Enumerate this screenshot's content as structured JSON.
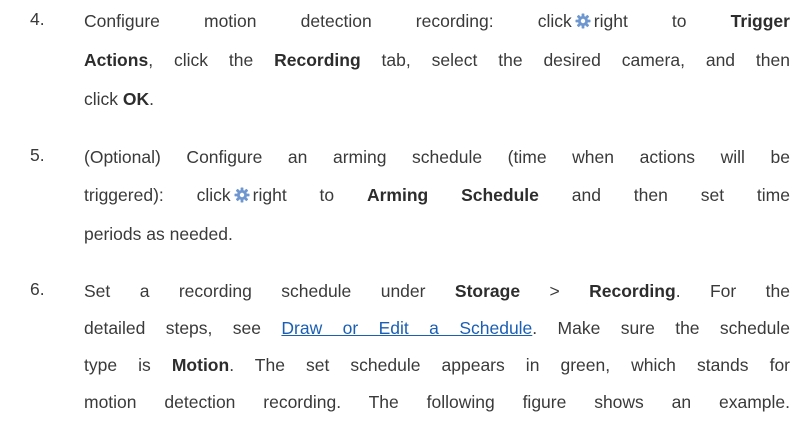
{
  "steps": [
    {
      "number": "4.",
      "lines": [
        {
          "justify": true,
          "parts": [
            {
              "t": "text",
              "v": "Configure motion detection recording: click"
            },
            {
              "t": "icon",
              "v": "gear-icon"
            },
            {
              "t": "text",
              "v": "right to "
            },
            {
              "t": "bold",
              "v": "Trigger"
            }
          ]
        },
        {
          "justify": true,
          "parts": [
            {
              "t": "bold",
              "v": "Actions"
            },
            {
              "t": "text",
              "v": ", click the "
            },
            {
              "t": "bold",
              "v": "Recording"
            },
            {
              "t": "text",
              "v": " tab, select the desired camera, and then"
            }
          ]
        },
        {
          "justify": false,
          "parts": [
            {
              "t": "text",
              "v": "click "
            },
            {
              "t": "bold",
              "v": "OK"
            },
            {
              "t": "text",
              "v": "."
            }
          ]
        }
      ]
    },
    {
      "number": "5.",
      "lines": [
        {
          "justify": true,
          "parts": [
            {
              "t": "text",
              "v": "(Optional) Configure an arming schedule (time when actions will be"
            }
          ]
        },
        {
          "justify": true,
          "parts": [
            {
              "t": "text",
              "v": "triggered): click"
            },
            {
              "t": "icon",
              "v": "gear-icon"
            },
            {
              "t": "text",
              "v": "right to "
            },
            {
              "t": "bold",
              "v": "Arming Schedule"
            },
            {
              "t": "text",
              "v": " and then set time"
            }
          ]
        },
        {
          "justify": false,
          "parts": [
            {
              "t": "text",
              "v": "periods as needed."
            }
          ]
        }
      ]
    },
    {
      "number": "6.",
      "lines": [
        {
          "justify": true,
          "parts": [
            {
              "t": "text",
              "v": "Set a recording schedule under "
            },
            {
              "t": "bold",
              "v": "Storage"
            },
            {
              "t": "text",
              "v": " > "
            },
            {
              "t": "bold",
              "v": "Recording"
            },
            {
              "t": "text",
              "v": ". For the"
            }
          ]
        },
        {
          "justify": true,
          "parts": [
            {
              "t": "text",
              "v": "detailed steps, see "
            },
            {
              "t": "link",
              "v": "Draw or Edit a Schedule"
            },
            {
              "t": "text",
              "v": ". Make sure the schedule"
            }
          ]
        },
        {
          "justify": true,
          "parts": [
            {
              "t": "text",
              "v": "type is "
            },
            {
              "t": "bold",
              "v": "Motion"
            },
            {
              "t": "text",
              "v": ". The set schedule appears in green, which stands for"
            }
          ]
        },
        {
          "justify": true,
          "parts": [
            {
              "t": "text",
              "v": "motion detection recording. The following figure shows an example."
            }
          ]
        }
      ]
    }
  ],
  "colors": {
    "text": "#3a3a3a",
    "link": "#1a5fb4",
    "gear_icon": "#6f97cf"
  }
}
